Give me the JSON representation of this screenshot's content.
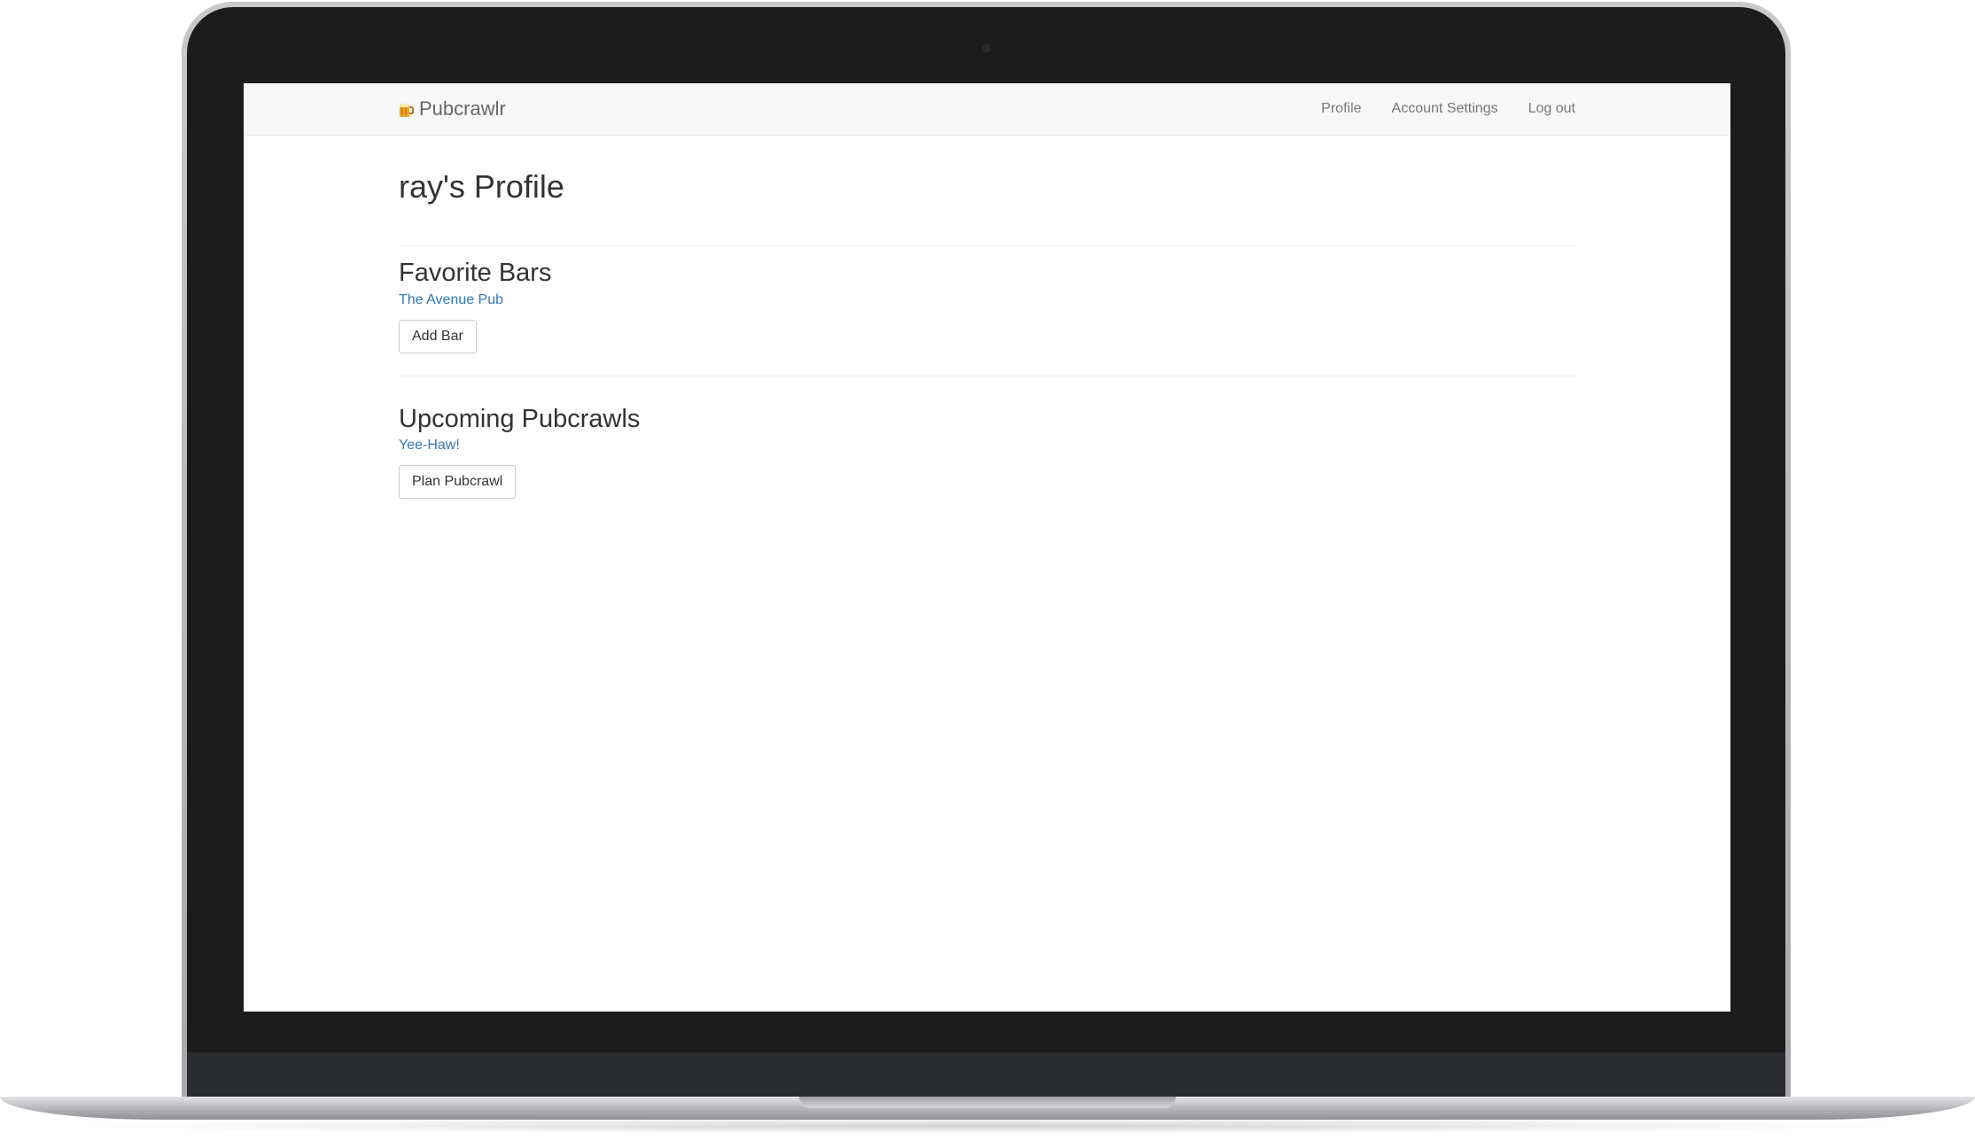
{
  "app": {
    "brand": "Pubcrawlr",
    "brand_icon": "beer-mug-icon"
  },
  "nav": {
    "items": [
      {
        "label": "Profile"
      },
      {
        "label": "Account Settings"
      },
      {
        "label": "Log out"
      }
    ]
  },
  "page": {
    "title": "ray's Profile"
  },
  "favorite_bars": {
    "heading": "Favorite Bars",
    "items": [
      {
        "name": "The Avenue Pub"
      }
    ],
    "add_button": "Add Bar"
  },
  "pubcrawls": {
    "heading": "Upcoming Pubcrawls",
    "items": [
      {
        "name": "Yee-Haw!"
      }
    ],
    "plan_button": "Plan Pubcrawl"
  },
  "colors": {
    "link": "#337ab7",
    "navbar_bg": "#f8f8f8",
    "text": "#333333",
    "bezel": "#1c1c1c"
  }
}
